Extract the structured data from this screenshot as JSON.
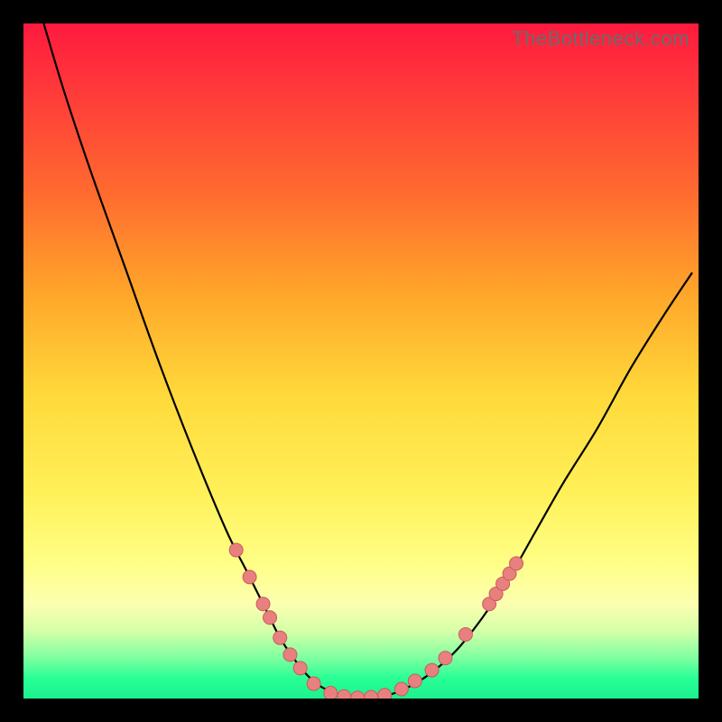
{
  "watermark": "TheBottleneck.com",
  "colors": {
    "page_bg": "#000000",
    "gradient_top": "#ff1a3e",
    "gradient_bottom": "#1bf28e",
    "curve": "#000000",
    "point_fill": "#e98080",
    "point_stroke": "#c95b5b"
  },
  "chart_data": {
    "type": "line",
    "title": "",
    "xlabel": "",
    "ylabel": "",
    "xlim": [
      0,
      100
    ],
    "ylim": [
      0,
      100
    ],
    "grid": false,
    "series": [
      {
        "name": "curve",
        "x": [
          3,
          6,
          10,
          15,
          20,
          25,
          30,
          33,
          36,
          38,
          40,
          42,
          44,
          47,
          50,
          53,
          56,
          60,
          64,
          68,
          72,
          76,
          80,
          85,
          90,
          95,
          99
        ],
        "y": [
          100,
          90,
          78,
          64,
          50,
          37,
          25,
          19,
          13,
          9,
          6,
          3.5,
          1.8,
          0.5,
          0,
          0.3,
          1.2,
          3.5,
          7,
          12,
          18,
          25,
          32,
          40,
          49,
          57,
          63
        ]
      }
    ],
    "points": [
      {
        "x": 31.5,
        "y": 22
      },
      {
        "x": 33.5,
        "y": 18
      },
      {
        "x": 35.5,
        "y": 14
      },
      {
        "x": 36.5,
        "y": 12
      },
      {
        "x": 38.0,
        "y": 9
      },
      {
        "x": 39.5,
        "y": 6.5
      },
      {
        "x": 41.0,
        "y": 4.5
      },
      {
        "x": 43.0,
        "y": 2.2
      },
      {
        "x": 45.5,
        "y": 0.8
      },
      {
        "x": 47.5,
        "y": 0.3
      },
      {
        "x": 49.5,
        "y": 0.1
      },
      {
        "x": 51.5,
        "y": 0.2
      },
      {
        "x": 53.5,
        "y": 0.5
      },
      {
        "x": 56.0,
        "y": 1.4
      },
      {
        "x": 58.0,
        "y": 2.6
      },
      {
        "x": 60.5,
        "y": 4.2
      },
      {
        "x": 62.5,
        "y": 6.0
      },
      {
        "x": 65.5,
        "y": 9.5
      },
      {
        "x": 69.0,
        "y": 14
      },
      {
        "x": 70.0,
        "y": 15.5
      },
      {
        "x": 71.0,
        "y": 17
      },
      {
        "x": 72.0,
        "y": 18.5
      },
      {
        "x": 73.0,
        "y": 20
      }
    ]
  }
}
